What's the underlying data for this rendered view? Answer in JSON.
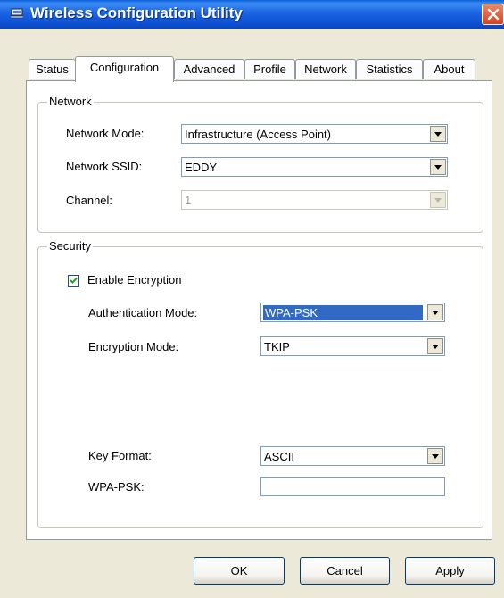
{
  "window": {
    "title": "Wireless Configuration Utility"
  },
  "tabs": [
    "Status",
    "Configuration",
    "Advanced",
    "Profile",
    "Network",
    "Statistics",
    "About"
  ],
  "active_tab": "Configuration",
  "network": {
    "group_title": "Network",
    "mode_label": "Network Mode:",
    "mode_value": "Infrastructure (Access Point)",
    "ssid_label": "Network SSID:",
    "ssid_value": "EDDY",
    "channel_label": "Channel:",
    "channel_value": "1"
  },
  "security": {
    "group_title": "Security",
    "enable_encryption_label": "Enable Encryption",
    "enable_encryption_checked": true,
    "auth_mode_label": "Authentication Mode:",
    "auth_mode_value": "WPA-PSK",
    "enc_mode_label": "Encryption Mode:",
    "enc_mode_value": "TKIP",
    "key_format_label": "Key Format:",
    "key_format_value": "ASCII",
    "wpa_psk_label": "WPA-PSK:",
    "wpa_psk_value": ""
  },
  "buttons": {
    "ok": "OK",
    "cancel": "Cancel",
    "apply": "Apply"
  },
  "colors": {
    "title_bar": "#1b64e3",
    "selection": "#316ac5",
    "window_bg": "#ece9d8",
    "close_button": "#d5431f"
  },
  "icons": {
    "app": "network-card-icon",
    "close": "close-icon",
    "dropdown": "chevron-down-icon",
    "check": "check-icon"
  }
}
